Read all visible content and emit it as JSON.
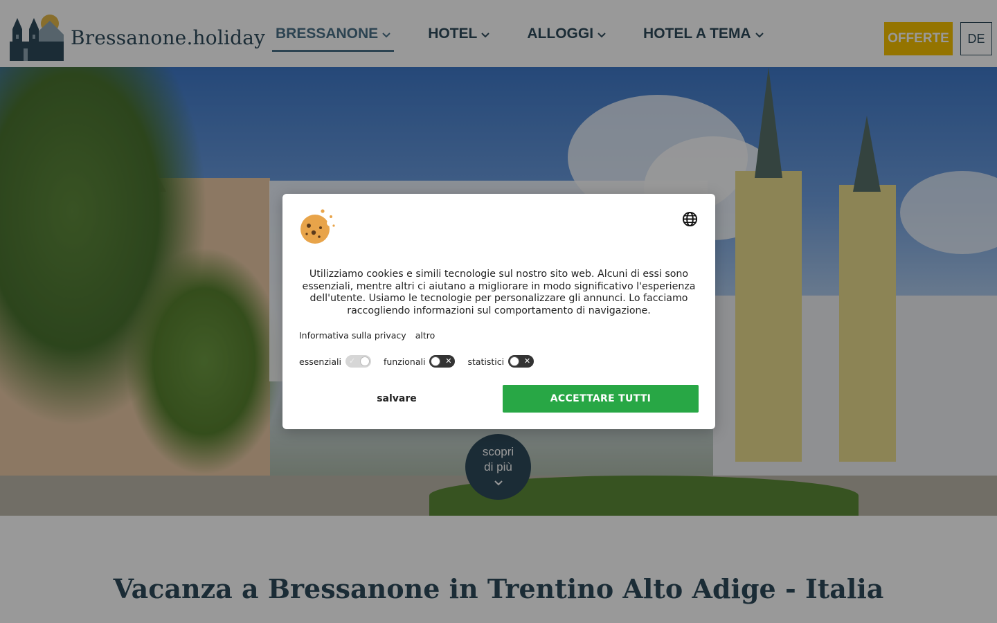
{
  "header": {
    "logo_text": "Bressanone.holiday",
    "nav": [
      {
        "label": "BRESSANONE",
        "active": true
      },
      {
        "label": "HOTEL",
        "active": false
      },
      {
        "label": "ALLOGGI",
        "active": false
      },
      {
        "label": "HOTEL A TEMA",
        "active": false
      }
    ],
    "offers_label": "OFFERTE",
    "lang_label": "DE"
  },
  "hero": {
    "discover_line1": "scopri",
    "discover_line2": "di più"
  },
  "main": {
    "title": "Vacanza a Bressanone in Trentino Alto Adige - Italia"
  },
  "cookie_banner": {
    "text": "Utilizziamo cookies e simili tecnologie sul nostro sito web. Alcuni di essi sono essenziali, mentre altri ci aiutano a migliorare in modo significativo l'esperienza dell'utente. Usiamo le tecnologie per personalizzare gli annunci. Lo facciamo raccogliendo informazioni sul comportamento di navigazione.",
    "privacy_link": "Informativa sulla privacy",
    "more_link": "altro",
    "toggles": [
      {
        "label": "essenziali",
        "state": "on"
      },
      {
        "label": "funzionali",
        "state": "off"
      },
      {
        "label": "statistici",
        "state": "off"
      }
    ],
    "save_label": "salvare",
    "accept_label": "ACCETTARE TUTTI"
  },
  "colors": {
    "brand_dark": "#2d4a5a",
    "offers_yellow": "#f7c200",
    "accept_green": "#28a745"
  },
  "icons": [
    "logo-church-icon",
    "chevron-down-icon",
    "cookie-icon",
    "globe-icon",
    "check-icon",
    "close-icon"
  ]
}
